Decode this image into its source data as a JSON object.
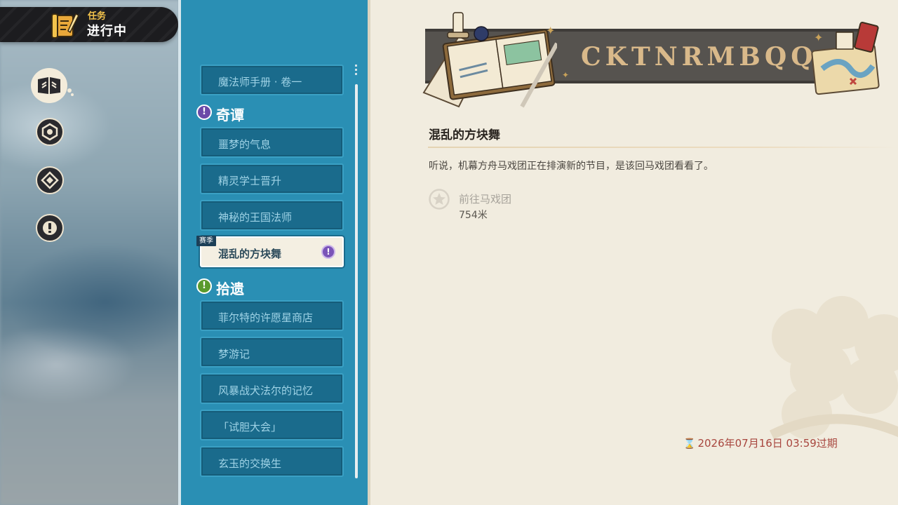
{
  "banner": {
    "subtitle": "任务",
    "title": "进行中"
  },
  "sidebar_categories": [
    {
      "name": "book-icon",
      "active": true
    },
    {
      "name": "hexagon-rune-icon",
      "active": false
    },
    {
      "name": "diamond-rune-icon",
      "active": false
    },
    {
      "name": "exclamation-icon",
      "active": false
    }
  ],
  "quest_list": {
    "top_item": "魔法师手册 · 卷一",
    "sections": [
      {
        "title": "奇谭",
        "badge": "!",
        "items": [
          {
            "label": "噩梦的气息"
          },
          {
            "label": "精灵学士晋升"
          },
          {
            "label": "神秘的王国法师"
          },
          {
            "label": "混乱的方块舞",
            "active": true,
            "tag": "赛季"
          }
        ]
      },
      {
        "title": "拾遗",
        "badge": "!",
        "items": [
          {
            "label": "菲尔特的许愿星商店"
          },
          {
            "label": "梦游记"
          },
          {
            "label": "风暴战犬法尔的记忆"
          },
          {
            "label": "「试胆大会」"
          },
          {
            "label": "玄玉的交换生"
          }
        ]
      }
    ]
  },
  "detail": {
    "header_runes": "CKTNRMBQQ<S",
    "title": "混乱的方块舞",
    "description": "听说，机幕方舟马戏团正在排演新的节目，是该回马戏团看看了。",
    "objective": {
      "text": "前往马戏团",
      "distance": "754米",
      "icon": "star-icon"
    },
    "expire": "2026年07月16日 03:59过期"
  },
  "colors": {
    "list_bg": "#2a8fb4",
    "item_bg": "#1a6b8c",
    "active_item_bg": "#f4efe2",
    "detail_bg": "#f1ecdf",
    "expire_red": "#a8463e",
    "banner_gold": "#f3c34c"
  }
}
